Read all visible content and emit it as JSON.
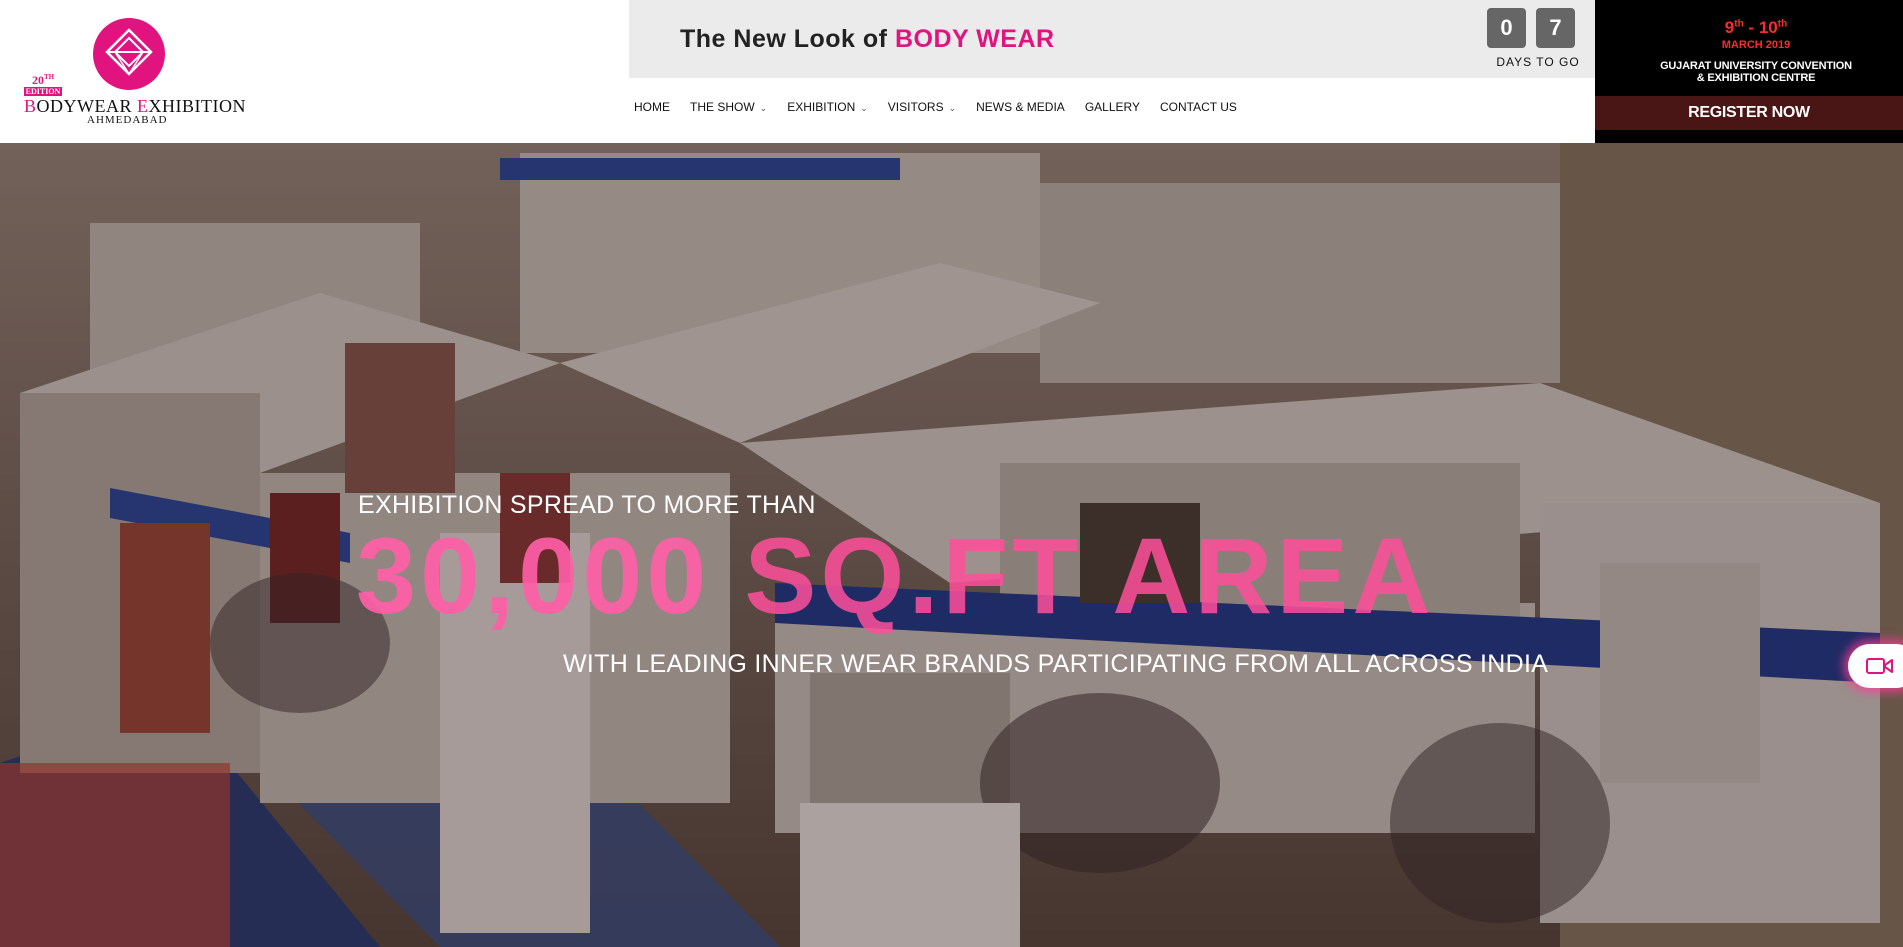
{
  "logo": {
    "edition_number": "20",
    "edition_suffix": "TH",
    "edition_word": "EDITION",
    "name_b": "B",
    "name_part1": "ODYWEAR ",
    "name_e": "E",
    "name_part2": "XHIBITION",
    "city": "AHMEDABAD"
  },
  "tagline": {
    "prefix": "The New Look of ",
    "highlight": "BODY WEAR"
  },
  "countdown": {
    "digit1": "0",
    "digit2": "7",
    "label": "DAYS TO GO"
  },
  "nav": {
    "items": [
      {
        "label": "HOME",
        "has_dropdown": false
      },
      {
        "label": "THE SHOW",
        "has_dropdown": true
      },
      {
        "label": "EXHIBITION",
        "has_dropdown": true
      },
      {
        "label": "VISITORS",
        "has_dropdown": true
      },
      {
        "label": "NEWS & MEDIA",
        "has_dropdown": false
      },
      {
        "label": "GALLERY",
        "has_dropdown": false
      },
      {
        "label": "CONTACT US",
        "has_dropdown": false
      }
    ]
  },
  "event": {
    "day1": "9",
    "day1_suffix": "th",
    "separator": " - ",
    "day2": "10",
    "day2_suffix": "th",
    "month_year": "MARCH 2019",
    "venue_line1": "GUJARAT UNIVERSITY CONVENTION",
    "venue_line2": "& EXHIBITION CENTRE",
    "register_label": "REGISTER NOW"
  },
  "hero": {
    "line1": "EXHIBITION SPREAD TO MORE THAN",
    "line2_number": "30,000",
    "line2_unit": " SQ.FT AREA",
    "line3": "WITH LEADING INNER WEAR BRANDS PARTICIPATING FROM ALL ACROSS INDIA"
  },
  "colors": {
    "brand_pink": "#e0137f",
    "date_red": "#ff2a2a",
    "register_bg": "#4a1515"
  },
  "icons": {
    "logo_mark": "diamond-emblem-icon",
    "dropdown": "chevron-down-icon",
    "video": "video-camera-icon"
  }
}
